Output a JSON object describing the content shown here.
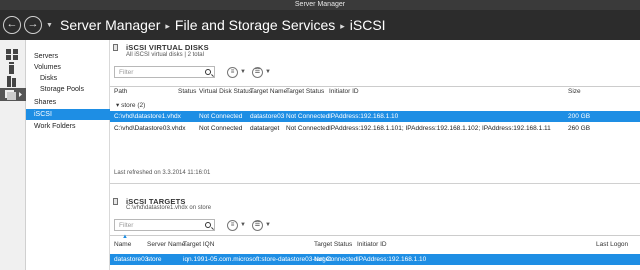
{
  "window": {
    "title": "Server Manager"
  },
  "header": {
    "breadcrumb": [
      "Server Manager",
      "File and Storage Services",
      "iSCSI"
    ]
  },
  "nav": {
    "items": [
      {
        "label": "Servers",
        "level": 0
      },
      {
        "label": "Volumes",
        "level": 0
      },
      {
        "label": "Disks",
        "level": 1
      },
      {
        "label": "Storage Pools",
        "level": 1
      },
      {
        "label": "Shares",
        "level": 0
      },
      {
        "label": "iSCSI",
        "level": 0,
        "active": true
      },
      {
        "label": "Work Folders",
        "level": 0
      }
    ]
  },
  "disks": {
    "title": "iSCSI VIRTUAL DISKS",
    "subtitle": "All iSCSI virtual disks | 2 total",
    "filter_placeholder": "Filter",
    "columns": [
      "Path",
      "Status",
      "Virtual Disk Status",
      "Target Name",
      "Target Status",
      "Initiator ID",
      "Size"
    ],
    "group_label": "store (2)",
    "rows": [
      {
        "path": "C:\\vhd\\datastore1.vhdx",
        "status": "",
        "vdstatus": "Not Connected",
        "target": "datastore03",
        "tstatus": "Not Connected",
        "initiator": "IPAddress:192.168.1.10",
        "size": "200 GB",
        "selected": true
      },
      {
        "path": "C:\\vhd\\Datastore03.vhdx",
        "status": "",
        "vdstatus": "Not Connected",
        "target": "datatarget",
        "tstatus": "Not Connected",
        "initiator": "IPAddress:192.168.1.101; IPAddress:192.168.1.102; IPAddress:192.168.1.11",
        "size": "260 GB",
        "selected": false
      }
    ],
    "last_refreshed": "Last refreshed on 3.3.2014 11:16:01"
  },
  "targets": {
    "title": "iSCSI TARGETS",
    "subtitle": "C:\\vhd\\datastore1.vhdx on store",
    "filter_placeholder": "Filter",
    "columns": [
      "Name",
      "Server Name",
      "Target IQN",
      "Target Status",
      "Initiator ID",
      "Last Logon"
    ],
    "rows": [
      {
        "name": "datastore03",
        "server": "store",
        "iqn": "iqn.1991-05.com.microsoft:store-datastore03-target",
        "tstatus": "Not Connected",
        "initiator": "IPAddress:192.168.1.10",
        "logon": "",
        "selected": true
      }
    ]
  },
  "colors": {
    "accent": "#1e8ee4",
    "header_bg": "#2c2c2c",
    "titlebar_bg": "#3a3a3a"
  }
}
